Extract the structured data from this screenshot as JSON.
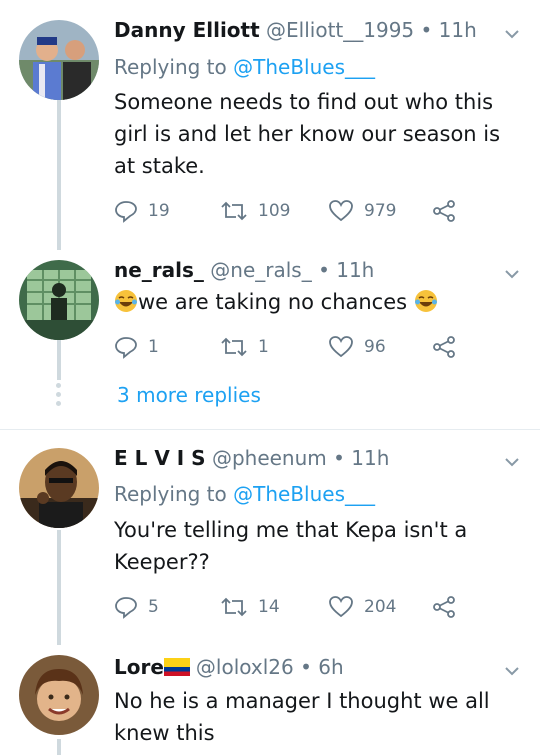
{
  "tweets": [
    {
      "name": "Danny Elliott",
      "handle": "@Elliott__1995",
      "time": "11h",
      "replying_prefix": "Replying to ",
      "replying_to": "@TheBlues___",
      "text": "Someone needs to find out who this girl is and let her know our season is at stake.",
      "replies": "19",
      "retweets": "109",
      "likes": "979"
    },
    {
      "name": "ne_rals_",
      "handle": "@ne_rals_",
      "time": "11h",
      "text": "we are taking no chances",
      "replies": "1",
      "retweets": "1",
      "likes": "96"
    },
    {
      "name": "E L V I S",
      "handle": "@pheenum",
      "time": "11h",
      "replying_prefix": "Replying to ",
      "replying_to": "@TheBlues___",
      "text": "You're telling me that Kepa isn't a Keeper??",
      "replies": "5",
      "retweets": "14",
      "likes": "204"
    },
    {
      "name": "Lore",
      "handle": "@loloxl26",
      "time": "6h",
      "text": "No he is a manager I thought we all knew this"
    }
  ],
  "more_replies": "3 more replies",
  "separator": "•",
  "colors": {
    "link": "#1da1f2",
    "muted": "#657786",
    "divider": "#e6ecf0"
  }
}
